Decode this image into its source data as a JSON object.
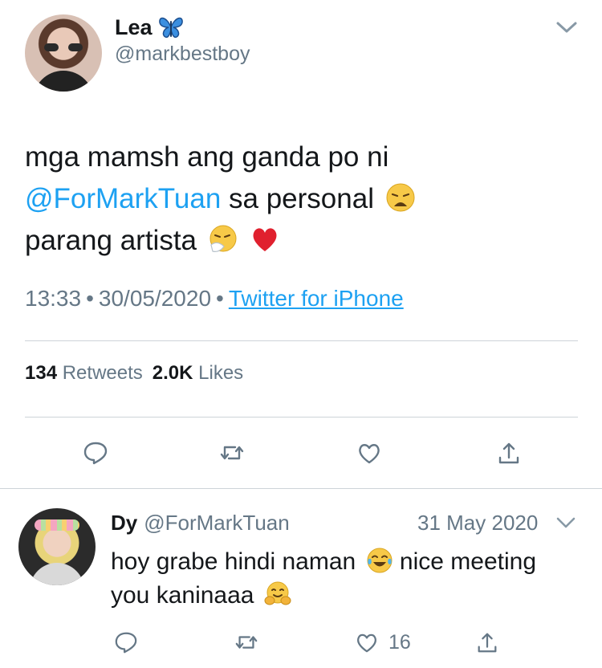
{
  "main_tweet": {
    "display_name": "Lea",
    "name_emoji": "butterfly-emoji",
    "handle": "@markbestboy",
    "text_line1": "mga mamsh ang ganda po ni",
    "mention": "@ForMarkTuan",
    "text_line2_rest": "sa personal",
    "text_line3": "parang artista",
    "time": "13:33",
    "dot1": "•",
    "date": "30/05/2020",
    "dot2": "•",
    "source": "Twitter for iPhone",
    "retweet_count": "134",
    "retweet_label": "Retweets",
    "like_count": "2.0K",
    "like_label": "Likes",
    "accent_color": "#1da1f2",
    "icons": [
      "reply-icon",
      "retweet-icon",
      "like-icon",
      "share-icon"
    ]
  },
  "reply_tweet": {
    "display_name": "Dy",
    "handle": "@ForMarkTuan",
    "date": "31 May 2020",
    "text_part1": "hoy grabe hindi naman",
    "text_part2": "nice meeting",
    "text_part3": "you kaninaaa",
    "like_count": "16",
    "icons": [
      "reply-icon",
      "retweet-icon",
      "like-icon",
      "share-icon"
    ]
  }
}
